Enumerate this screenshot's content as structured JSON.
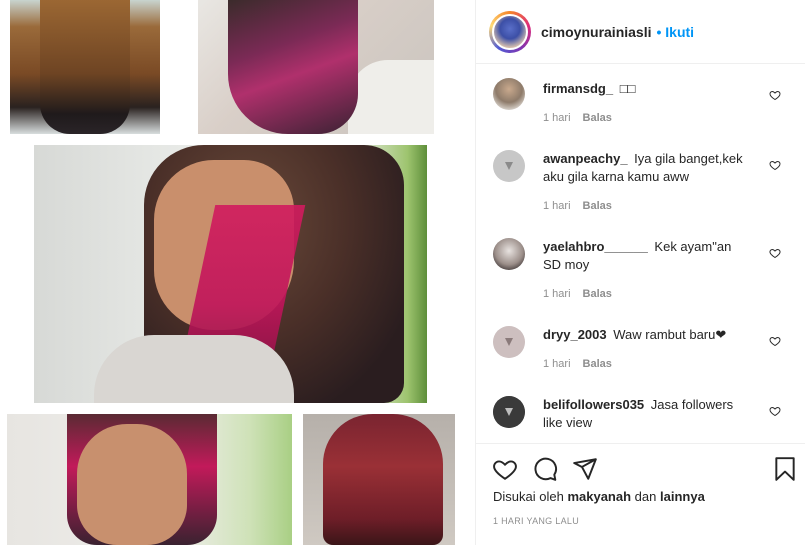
{
  "post": {
    "username": "cimoynurainiasli",
    "separator": "•",
    "follow_label": "Ikuti"
  },
  "comments": [
    {
      "user": "firmansdg_",
      "text": "□□",
      "time": "1 hari",
      "reply": "Balas"
    },
    {
      "user": "awanpeachy_",
      "text": "Iya gila banget,kek aku gila karna kamu aww",
      "time": "1 hari",
      "reply": "Balas"
    },
    {
      "user": "yaelahbro______",
      "text": "Kek ayam\"an SD moy",
      "time": "1 hari",
      "reply": "Balas"
    },
    {
      "user": "dryy_2003",
      "text": "Waw rambut baru❤",
      "time": "1 hari",
      "reply": "Balas"
    },
    {
      "user": "belifollowers035",
      "text": "Jasa followers like view",
      "time": "",
      "reply": ""
    }
  ],
  "likes": {
    "prefix": "Disukai oleh",
    "user": "makyanah",
    "connector": "dan",
    "others": "lainnya"
  },
  "timestamp": "1 HARI YANG LALU",
  "colors": {
    "follow_blue": "#0095f6",
    "meta_gray": "#8e8e8e",
    "text": "#262626",
    "border": "#efefef"
  },
  "icons": [
    "heart-icon",
    "comment-icon",
    "share-icon",
    "bookmark-icon",
    "like-comment-heart-icon"
  ]
}
